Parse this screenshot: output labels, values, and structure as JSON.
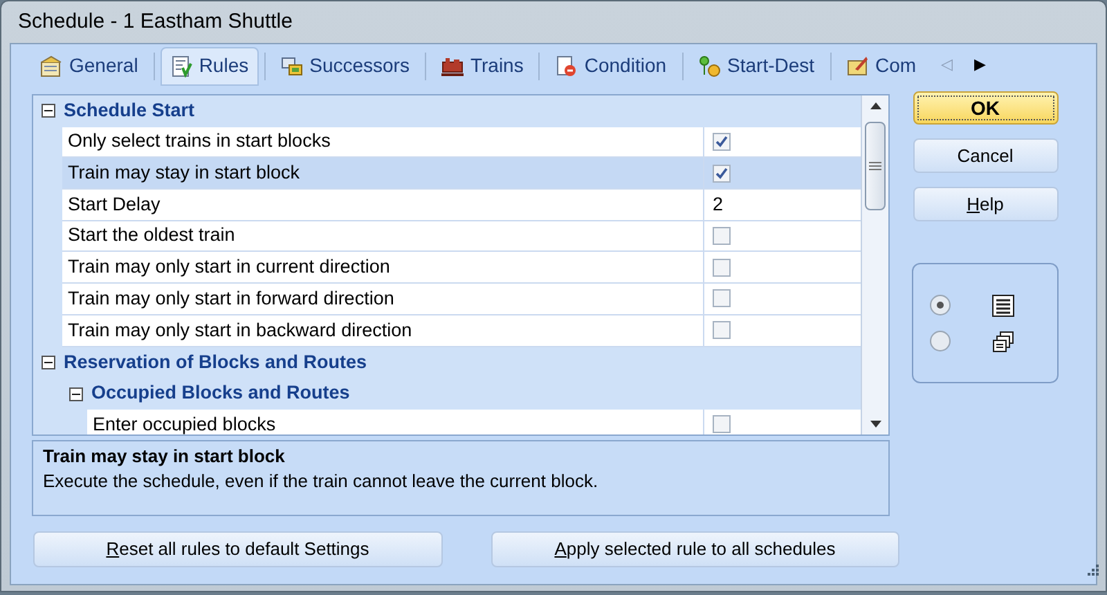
{
  "window": {
    "title": "Schedule - 1 Eastham Shuttle"
  },
  "tabs": [
    {
      "label": "General",
      "selected": false
    },
    {
      "label": "Rules",
      "selected": true
    },
    {
      "label": "Successors",
      "selected": false
    },
    {
      "label": "Trains",
      "selected": false
    },
    {
      "label": "Condition",
      "selected": false
    },
    {
      "label": "Start-Dest",
      "selected": false
    },
    {
      "label": "Com",
      "selected": false
    }
  ],
  "tab_scroll": [
    {
      "label": "◁",
      "disabled": true
    },
    {
      "label": "▶",
      "disabled": false
    }
  ],
  "grid": {
    "rows": [
      {
        "kind": "category",
        "label": "Schedule Start",
        "expanded": true,
        "children": [
          {
            "kind": "checkbox",
            "label": "Only select trains in start blocks",
            "checked": true,
            "selected": false
          },
          {
            "kind": "checkbox",
            "label": "Train may stay in start block",
            "checked": true,
            "selected": true
          },
          {
            "kind": "value",
            "label": "Start Delay",
            "value": "2",
            "selected": false
          },
          {
            "kind": "checkbox",
            "label": "Start the oldest train",
            "checked": false,
            "selected": false
          },
          {
            "kind": "checkbox",
            "label": "Train may only start in current direction",
            "checked": false,
            "selected": false
          },
          {
            "kind": "checkbox",
            "label": "Train may only start in forward direction",
            "checked": false,
            "selected": false
          },
          {
            "kind": "checkbox",
            "label": "Train may only start in backward direction",
            "checked": false,
            "selected": false
          }
        ]
      },
      {
        "kind": "category",
        "label": "Reservation of Blocks and Routes",
        "expanded": true,
        "children": [
          {
            "kind": "category",
            "label": "Occupied Blocks and Routes",
            "expanded": true,
            "children": [
              {
                "kind": "checkbox",
                "label": "Enter occupied blocks",
                "checked": false,
                "selected": false
              }
            ]
          }
        ]
      }
    ]
  },
  "description": {
    "title": "Train may stay in start block",
    "text": "Execute the schedule, even if the train cannot leave the current block."
  },
  "bottom_buttons": [
    {
      "mnemonic": "R",
      "rest": "eset all rules to default Settings"
    },
    {
      "mnemonic": "A",
      "rest": "pply selected rule to all schedules"
    }
  ],
  "side_buttons": [
    {
      "rest": "OK",
      "default": true
    },
    {
      "rest": "Cancel",
      "default": false
    },
    {
      "mnemonic": "H",
      "rest": "elp",
      "default": false
    }
  ],
  "view_options": [
    {
      "selected": true
    },
    {
      "selected": false
    }
  ]
}
